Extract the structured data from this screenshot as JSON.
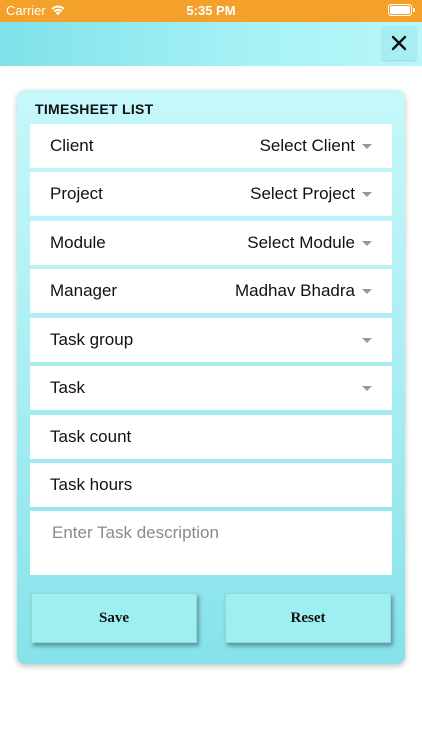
{
  "status_bar": {
    "carrier": "Carrier",
    "time": "5:35 PM"
  },
  "header": {
    "close_icon": "close-icon"
  },
  "form": {
    "title": "TIMESHEET LIST",
    "fields": [
      {
        "label": "Client",
        "value": "Select Client",
        "dropdown": true
      },
      {
        "label": "Project",
        "value": "Select Project",
        "dropdown": true
      },
      {
        "label": "Module",
        "value": "Select Module",
        "dropdown": true
      },
      {
        "label": "Manager",
        "value": "Madhav Bhadra",
        "dropdown": true
      },
      {
        "label": "Task group",
        "value": "",
        "dropdown": true
      },
      {
        "label": "Task",
        "value": "",
        "dropdown": true
      },
      {
        "label": "Task count",
        "value": "",
        "dropdown": false
      },
      {
        "label": "Task hours",
        "value": "",
        "dropdown": false
      }
    ],
    "description_placeholder": "Enter Task description",
    "save_label": "Save",
    "reset_label": "Reset"
  },
  "colors": {
    "status_bar": "#f3a12a",
    "accent": "#9deff2",
    "card_top": "#c6f8fa",
    "card_bottom": "#86e2ea"
  }
}
